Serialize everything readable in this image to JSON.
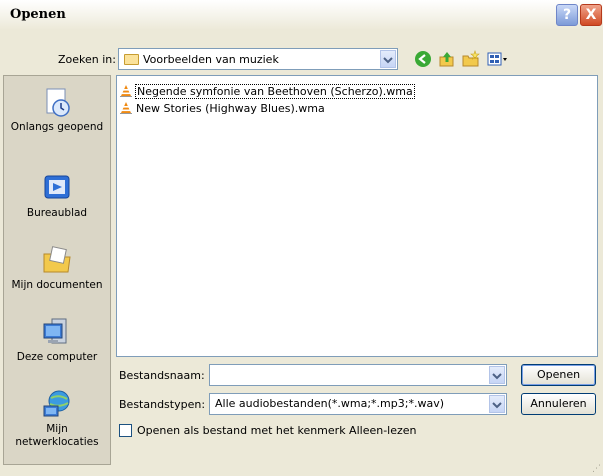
{
  "window": {
    "title": "Openen",
    "help_glyph": "?",
    "close_glyph": "X"
  },
  "lookin": {
    "label": "Zoeken in:",
    "value": "Voorbeelden van muziek"
  },
  "toolbar": {
    "icons": [
      "back-icon",
      "up-folder-icon",
      "new-folder-icon",
      "view-menu-icon"
    ]
  },
  "places": [
    {
      "label": "Onlangs geopend",
      "icon": "recent-icon"
    },
    {
      "label": "Bureaublad",
      "icon": "desktop-icon"
    },
    {
      "label": "Mijn documenten",
      "icon": "my-documents-icon"
    },
    {
      "label": "Deze computer",
      "icon": "computer-icon"
    },
    {
      "label": "Mijn netwerklocaties",
      "icon": "network-icon"
    }
  ],
  "files": [
    {
      "name": "Negende symfonie van Beethoven (Scherzo).wma",
      "icon": "vlc-icon"
    },
    {
      "name": "New Stories (Highway Blues).wma",
      "icon": "vlc-icon"
    }
  ],
  "filename": {
    "label": "Bestandsnaam:",
    "value": ""
  },
  "filetype": {
    "label": "Bestandstypen:",
    "value": "Alle audiobestanden(*.wma;*.mp3;*.wav)"
  },
  "buttons": {
    "open": "Openen",
    "cancel": "Annuleren"
  },
  "readonly": {
    "label": "Openen als bestand met het kenmerk Alleen-lezen",
    "checked": false
  }
}
